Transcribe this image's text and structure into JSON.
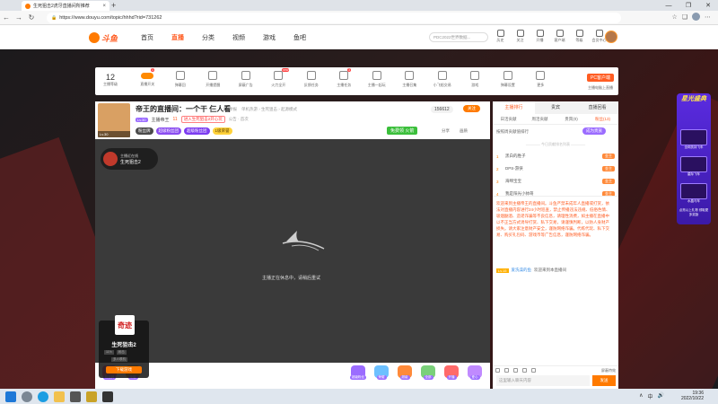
{
  "browser": {
    "tab_title": "生死狙击2虎牙直播间所推荐",
    "tab_close": "×",
    "new_tab": "+",
    "url": "https://www.douyu.com/topic/hhhd?rid=731262",
    "win_min": "—",
    "win_max": "❐",
    "win_close": "✕"
  },
  "header": {
    "logo_text": "斗鱼",
    "nav": [
      "首页",
      "直播",
      "分类",
      "视频",
      "游戏",
      "鱼吧"
    ],
    "nav_active": "直播",
    "search_placeholder": "PDC2022世界数据...",
    "icons": [
      "历史",
      "关注",
      "开播",
      "客户端",
      "等级",
      "会员中心"
    ]
  },
  "func_bar": {
    "level_num": "12",
    "level_label": "主播等级",
    "items": [
      {
        "label": "直播开关",
        "badge": "1"
      },
      {
        "label": "弹幕回"
      },
      {
        "label": "开播提醒"
      },
      {
        "label": "屏蔽广告"
      },
      {
        "label": "火力全开",
        "badge": "new"
      },
      {
        "label": "反馈任务"
      },
      {
        "label": "主播任务",
        "badge": "3"
      },
      {
        "label": "主播一起玩"
      },
      {
        "label": "主播召集"
      },
      {
        "label": "小飞船交易"
      },
      {
        "label": "游戏"
      },
      {
        "label": "弹幕设置"
      },
      {
        "label": "更多"
      }
    ],
    "pc_client": "PC客户端",
    "pc_sub": "主播电脑上直播"
  },
  "room": {
    "title": "帝王的直播间：一个干 仨人看",
    "report": "举报",
    "categories": "单机热游 › 生死狙击 › 起源模式",
    "level_tag": "Lv.30",
    "anchor_name": "主播帝王",
    "hot": "11",
    "red_tag": "进入生死狙击2开心玩",
    "announce": "公告 · 首次",
    "pills": [
      "粉丝牌",
      "超级粉丝团",
      "超级粉丝团",
      "1级荣誉"
    ],
    "room_id": "156612",
    "follow": "关注",
    "gift_green": "免费领 火箭",
    "share": "分享",
    "adjust": "画质"
  },
  "video": {
    "anchor_caption": "主播近在线",
    "anchor_game": "生死狙击2",
    "offline_msg": "主播正在休息中，请稍后重试",
    "popup": {
      "logo": "奇迹",
      "name": "生死狙击2",
      "meta": [
        "11%",
        "射击"
      ],
      "meta2": "多人联机",
      "button": "下载游戏"
    }
  },
  "gifts_left": [
    "粉丝牌",
    "荣耀"
  ],
  "gifts_right": [
    "超级粉丝",
    "荣耀",
    "超级",
    "全部",
    "开播",
    "爱心"
  ],
  "right_panel": {
    "top_tabs": [
      "主播排行",
      "贵宾",
      "直播回看"
    ],
    "tabs": [
      "日活贡献",
      "周活贡献",
      "贵宾(0)",
      "粉丝(13)"
    ],
    "stat": "按照周贡献值排行",
    "become": "成为贵族",
    "sep": "———— 今日贡献排名列表 ————",
    "rank": [
      {
        "n": "1",
        "name": "黑白的胜子",
        "tag": "金主"
      },
      {
        "n": "2",
        "name": "DPS-游侠",
        "tag": "金主"
      },
      {
        "n": "3",
        "name": "海绵宝宝",
        "tag": "金主"
      },
      {
        "n": "4",
        "name": "我是阳光小帅哥",
        "tag": "金主"
      }
    ],
    "sys_msg": "欢迎来到主播帝王的直播间。斗鱼严禁未成年人直播或打赏，依法对直播内容进行24小时巡查，禁止传播违法违规、低俗色情、吸烟酗酒、造谣诈骗等不良信息，请理性消费，如主播在直播中以不正当方式诱导打赏、私下交易，请谨慎判断，以防人身财产损失。请大家注意财产安全，谨防网络诈骗。代练代玩、私下交易、购买礼包码、游戏币等广告信息，谨防网络诈骗。",
    "welcome_lv": "Lv.15",
    "welcome_user": "爱洗澡的鱼",
    "welcome_text": "欢迎来到本直播间",
    "toolbar_right": "屏蔽特效",
    "input_placeholder": "这里输入聊天内容",
    "send": "发送"
  },
  "promo": {
    "title": "星光盛典",
    "items": [
      "全网扶持飞车",
      "星际飞车",
      "水晶马车"
    ],
    "foot": "点亮以上礼物 领取更多奖励"
  },
  "taskbar": {
    "time": "19:36",
    "date": "2022/10/22",
    "tray": [
      "∧",
      "中",
      "🔊"
    ]
  },
  "colors": {
    "accent": "#ff5d23",
    "orange": "#ff7a00",
    "purple": "#9b6cff"
  }
}
